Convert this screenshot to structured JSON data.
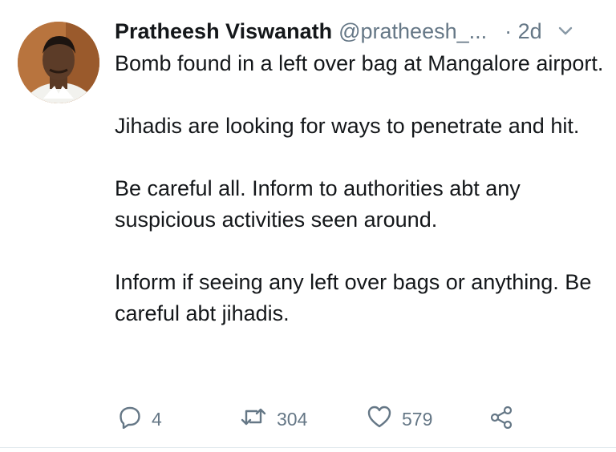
{
  "author": {
    "display_name": "Pratheesh Viswanath",
    "handle": "@pratheesh_...",
    "time": "· 2d"
  },
  "tweet": {
    "paragraphs": [
      "Bomb found in a left over bag at Mangalore airport.",
      "Jihadis are looking for ways to penetrate and hit.",
      "Be careful all. Inform to authorities abt any suspicious activities seen around.",
      "Inform if seeing any left over bags or anything. Be careful abt jihadis."
    ]
  },
  "actions": {
    "reply_count": "4",
    "retweet_count": "304",
    "like_count": "579"
  },
  "icons": {
    "reply": "reply-icon",
    "retweet": "retweet-icon",
    "like": "heart-icon",
    "share": "share-icon",
    "menu": "chevron-down-icon"
  },
  "colors": {
    "text": "#14171a",
    "secondary": "#657786"
  }
}
